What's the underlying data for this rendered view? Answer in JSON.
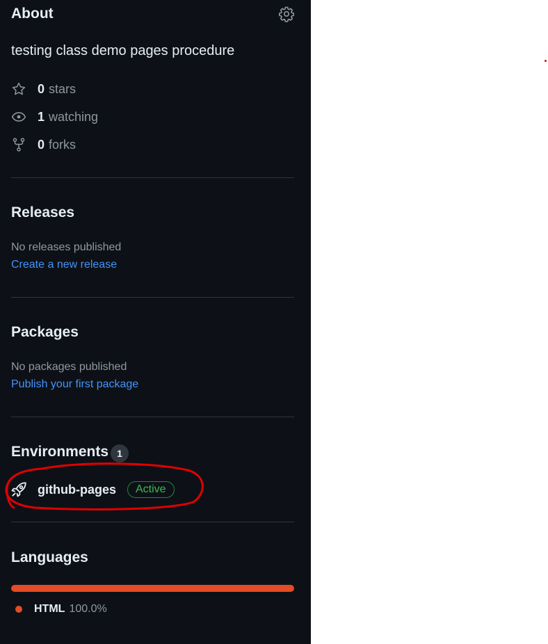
{
  "about": {
    "title": "About",
    "settings_icon": "gear-icon",
    "description": "testing class demo pages procedure",
    "stats": [
      {
        "icon": "star-icon",
        "count": "0",
        "label": "stars"
      },
      {
        "icon": "eye-icon",
        "count": "1",
        "label": "watching"
      },
      {
        "icon": "repo-forked-icon",
        "count": "0",
        "label": "forks"
      }
    ]
  },
  "releases": {
    "title": "Releases",
    "empty_text": "No releases published",
    "create_link": "Create a new release"
  },
  "packages": {
    "title": "Packages",
    "empty_text": "No packages published",
    "publish_link": "Publish your first package"
  },
  "environments": {
    "title": "Environments",
    "count": "1",
    "items": [
      {
        "icon": "rocket-icon",
        "name": "github-pages",
        "status": "Active"
      }
    ]
  },
  "languages": {
    "title": "Languages",
    "items": [
      {
        "name": "HTML",
        "percent": "100.0%",
        "fraction": 1.0,
        "color": "#e34c26"
      }
    ]
  },
  "colors": {
    "background": "#0d1117",
    "text": "#e6edf3",
    "muted": "#9198a1",
    "link": "#4493f8",
    "active_green": "#3fb950",
    "annotation_red": "#e00000"
  }
}
